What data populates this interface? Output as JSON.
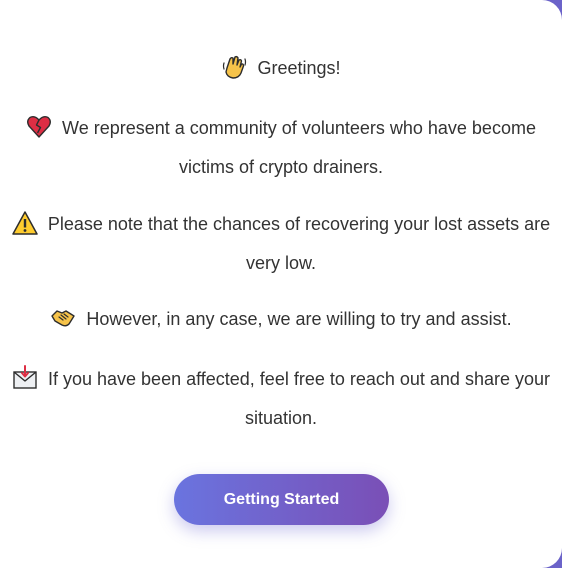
{
  "messages": [
    {
      "icon": "waving-hand-icon",
      "text": "Greetings!"
    },
    {
      "icon": "broken-heart-icon",
      "text": "We represent a community of volunteers who have become victims of crypto drainers."
    },
    {
      "icon": "warning-icon",
      "text": "Please note that the chances of recovering your lost assets are very low."
    },
    {
      "icon": "handshake-icon",
      "text": "However, in any case, we are willing to try and assist."
    },
    {
      "icon": "incoming-envelope-icon",
      "text": "If you have been affected, feel free to reach out and share your situation."
    }
  ],
  "cta": {
    "label": "Getting Started"
  },
  "colors": {
    "background": "#6b63c9",
    "card": "#ffffff",
    "text": "#333333",
    "button_gradient_start": "#6a74df",
    "button_gradient_end": "#7a4fb6"
  }
}
